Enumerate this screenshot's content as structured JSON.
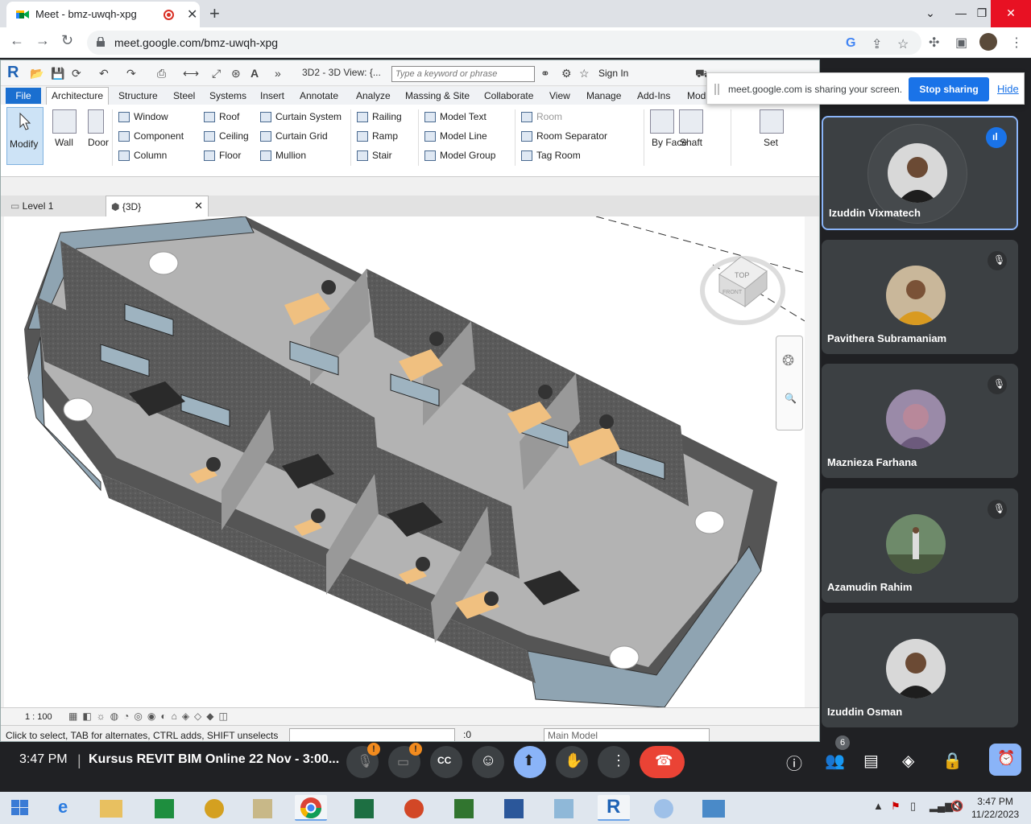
{
  "browser": {
    "tab_title": "Meet - bmz-uwqh-xpg",
    "url": "meet.google.com/bmz-uwqh-xpg"
  },
  "revit": {
    "view_title": "3D2 - 3D View: {...",
    "search_placeholder": "Type a keyword or phrase",
    "sign_in": "Sign In",
    "ribbon_tabs": [
      "File",
      "Architecture",
      "Structure",
      "Steel",
      "Systems",
      "Insert",
      "Annotate",
      "Analyze",
      "Massing & Site",
      "Collaborate",
      "View",
      "Manage",
      "Add-Ins",
      "Mod"
    ],
    "tools": {
      "modify": "Modify",
      "wall": "Wall",
      "door": "Door",
      "window": "Window",
      "component": "Component",
      "column": "Column",
      "roof": "Roof",
      "ceiling": "Ceiling",
      "floor": "Floor",
      "curtain_system": "Curtain System",
      "curtain_grid": "Curtain Grid",
      "mullion": "Mullion",
      "railing": "Railing",
      "ramp": "Ramp",
      "stair": "Stair",
      "model_text": "Model Text",
      "model_line": "Model Line",
      "model_group": "Model Group",
      "room": "Room",
      "room_separator": "Room Separator",
      "tag_room": "Tag Room",
      "by_face": "By Face",
      "shaft": "Shaft",
      "set": "Set"
    },
    "view_tabs": [
      "Level 1",
      "{3D}"
    ],
    "viewcube_top": "TOP",
    "viewcube_front": "FRONT",
    "scale": "1 : 100",
    "status_message": "Click to select, TAB for alternates, CTRL adds, SHIFT unselects",
    "selection_count": ":0",
    "model_selector": "Main Model"
  },
  "share_banner": {
    "message": "meet.google.com is sharing your screen.",
    "stop": "Stop sharing",
    "hide": "Hide"
  },
  "participants": [
    {
      "name": "Izuddin Vixmatech",
      "state": "speaking"
    },
    {
      "name": "Pavithera Subramaniam",
      "state": "muted"
    },
    {
      "name": "Maznieza Farhana",
      "state": "muted"
    },
    {
      "name": "Azamudin Rahim",
      "state": "muted"
    },
    {
      "name": "Izuddin Osman",
      "state": "video"
    }
  ],
  "meeting": {
    "time": "3:47 PM",
    "separator": "|",
    "title": "Kursus REVIT BIM Online 22 Nov - 3:00...",
    "warning_mark": "!",
    "participant_count": "6"
  },
  "taskbar": {
    "clock_time": "3:47 PM",
    "clock_date": "11/22/2023"
  },
  "colors": {
    "meet_dark": "#202124",
    "tile_bg": "#3c4043",
    "accent_blue": "#1a73e8",
    "leave_red": "#ea4335",
    "revit_blue": "#1a6fd0"
  }
}
